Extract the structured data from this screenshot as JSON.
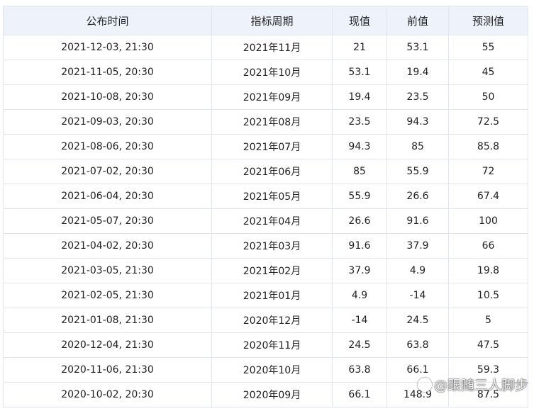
{
  "table": {
    "headers": [
      "公布时间",
      "指标周期",
      "现值",
      "前值",
      "预测值"
    ],
    "rows": [
      [
        "2021-12-03, 21:30",
        "2021年11月",
        "21",
        "53.1",
        "55"
      ],
      [
        "2021-11-05, 20:30",
        "2021年10月",
        "53.1",
        "19.4",
        "45"
      ],
      [
        "2021-10-08, 20:30",
        "2021年09月",
        "19.4",
        "23.5",
        "50"
      ],
      [
        "2021-09-03, 20:30",
        "2021年08月",
        "23.5",
        "94.3",
        "72.5"
      ],
      [
        "2021-08-06, 20:30",
        "2021年07月",
        "94.3",
        "85",
        "85.8"
      ],
      [
        "2021-07-02, 20:30",
        "2021年06月",
        "85",
        "55.9",
        "72"
      ],
      [
        "2021-06-04, 20:30",
        "2021年05月",
        "55.9",
        "26.6",
        "67.4"
      ],
      [
        "2021-05-07, 20:30",
        "2021年04月",
        "26.6",
        "91.6",
        "100"
      ],
      [
        "2021-04-02, 20:30",
        "2021年03月",
        "91.6",
        "37.9",
        "66"
      ],
      [
        "2021-03-05, 21:30",
        "2021年02月",
        "37.9",
        "4.9",
        "19.8"
      ],
      [
        "2021-02-05, 21:30",
        "2021年01月",
        "4.9",
        "-14",
        "10.5"
      ],
      [
        "2021-01-08, 21:30",
        "2020年12月",
        "-14",
        "24.5",
        "5"
      ],
      [
        "2020-12-04, 21:30",
        "2020年11月",
        "24.5",
        "63.8",
        "47.5"
      ],
      [
        "2020-11-06, 21:30",
        "2020年10月",
        "63.8",
        "66.1",
        "59.3"
      ],
      [
        "2020-10-02, 20:30",
        "2020年09月",
        "66.1",
        "148.9",
        "87.5"
      ]
    ]
  },
  "watermark": {
    "text": "@跟随三人脚步"
  }
}
